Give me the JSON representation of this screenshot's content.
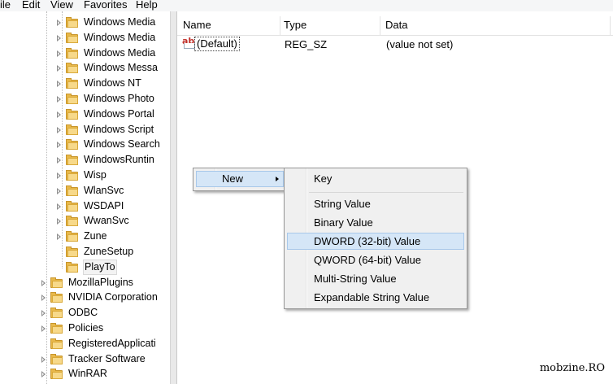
{
  "menubar": {
    "items": [
      "ile",
      "Edit",
      "View",
      "Favorites",
      "Help"
    ]
  },
  "tree": {
    "items": [
      {
        "label": "Windows Media",
        "indent": 2,
        "expander": true
      },
      {
        "label": "Windows Media",
        "indent": 2,
        "expander": true
      },
      {
        "label": "Windows Media",
        "indent": 2,
        "expander": true
      },
      {
        "label": "Windows Messa",
        "indent": 2,
        "expander": true
      },
      {
        "label": "Windows NT",
        "indent": 2,
        "expander": true
      },
      {
        "label": "Windows Photo",
        "indent": 2,
        "expander": true
      },
      {
        "label": "Windows Portal",
        "indent": 2,
        "expander": true
      },
      {
        "label": "Windows Script",
        "indent": 2,
        "expander": true
      },
      {
        "label": "Windows Search",
        "indent": 2,
        "expander": true
      },
      {
        "label": "WindowsRuntin",
        "indent": 2,
        "expander": true
      },
      {
        "label": "Wisp",
        "indent": 2,
        "expander": true
      },
      {
        "label": "WlanSvc",
        "indent": 2,
        "expander": true
      },
      {
        "label": "WSDAPI",
        "indent": 2,
        "expander": true
      },
      {
        "label": "WwanSvc",
        "indent": 2,
        "expander": true
      },
      {
        "label": "Zune",
        "indent": 2,
        "expander": true
      },
      {
        "label": "ZuneSetup",
        "indent": 2,
        "expander": false
      },
      {
        "label": "PlayTo",
        "indent": 2,
        "expander": false,
        "selected": true
      },
      {
        "label": "MozillaPlugins",
        "indent": 1,
        "expander": true
      },
      {
        "label": "NVIDIA Corporation",
        "indent": 1,
        "expander": true
      },
      {
        "label": "ODBC",
        "indent": 1,
        "expander": true
      },
      {
        "label": "Policies",
        "indent": 1,
        "expander": true
      },
      {
        "label": "RegisteredApplicati",
        "indent": 1,
        "expander": false
      },
      {
        "label": "Tracker Software",
        "indent": 1,
        "expander": true
      },
      {
        "label": "WinRAR",
        "indent": 1,
        "expander": true
      }
    ]
  },
  "list": {
    "columns": [
      "Name",
      "Type",
      "Data"
    ],
    "rows": [
      {
        "icon": "string-value-icon",
        "icon_text": "ab",
        "name": "(Default)",
        "type": "REG_SZ",
        "data": "(value not set)"
      }
    ]
  },
  "context_menu": {
    "new_label": "New"
  },
  "submenu": {
    "key_label": "Key",
    "items": [
      "String Value",
      "Binary Value",
      "DWORD (32-bit) Value",
      "QWORD (64-bit) Value",
      "Multi-String Value",
      "Expandable String Value"
    ],
    "highlighted": "DWORD (32-bit) Value"
  },
  "watermark": "mobzine.RO",
  "colors": {
    "highlight": "#d5e6f7",
    "menu_bg": "#f0f0f0",
    "folder": "#e8b84a"
  }
}
